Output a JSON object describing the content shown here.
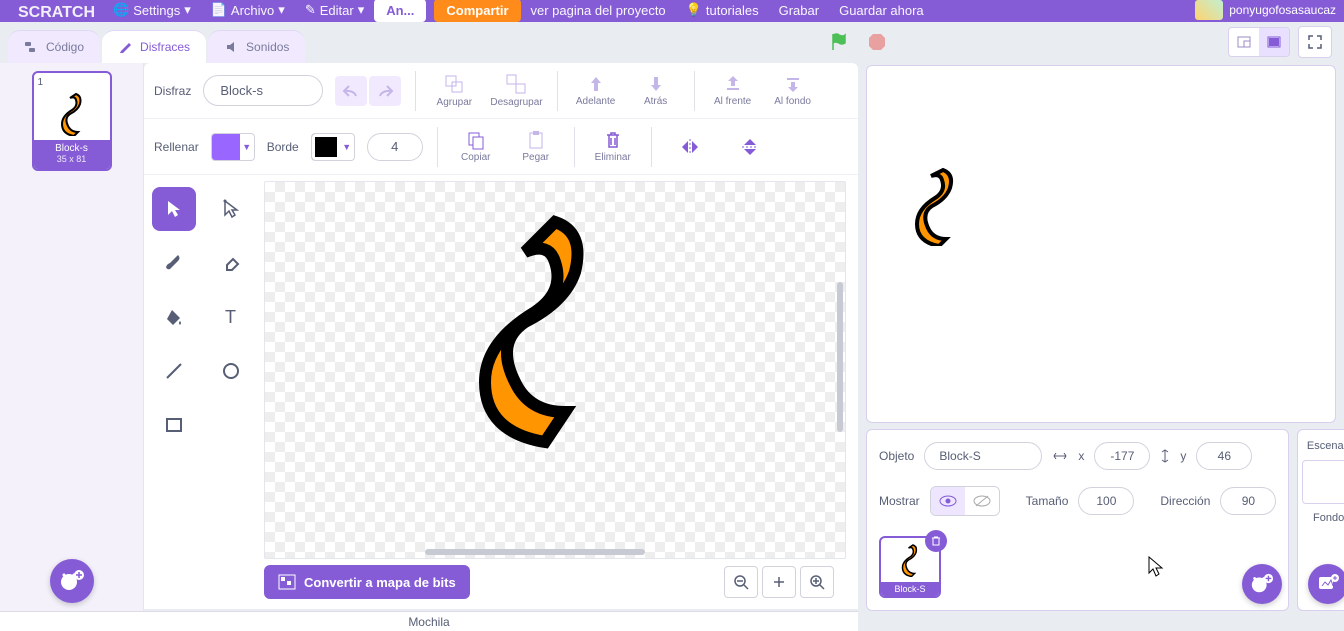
{
  "menu": {
    "settings": "Settings",
    "archivo": "Archivo",
    "editar": "Editar",
    "an": "An...",
    "compartir": "Compartir",
    "ver_pagina": "ver pagina del proyecto",
    "tutoriales": "tutoriales",
    "grabar": "Grabar",
    "guardar": "Guardar ahora",
    "username": "ponyugofosasaucaz"
  },
  "tabs": {
    "codigo": "Código",
    "disfraces": "Disfraces",
    "sonidos": "Sonidos"
  },
  "costume_list": {
    "index": "1",
    "name": "Block-s",
    "dims": "35 x 81"
  },
  "paint": {
    "costume_lbl": "Disfraz",
    "costume_name": "Block-s",
    "agrupar": "Agrupar",
    "desagrupar": "Desagrupar",
    "adelante": "Adelante",
    "atras": "Atrás",
    "al_frente": "Al frente",
    "al_fondo": "Al fondo",
    "rellenar": "Rellenar",
    "borde": "Borde",
    "outline_w": "4",
    "copiar": "Copiar",
    "pegar": "Pegar",
    "eliminar": "Eliminar",
    "fill_color": "#9966ff",
    "border_color": "#000000",
    "convert": "Convertir a mapa de bits"
  },
  "sprite": {
    "objeto_lbl": "Objeto",
    "name": "Block-S",
    "x_lbl": "x",
    "x": "-177",
    "y_lbl": "y",
    "y": "46",
    "mostrar": "Mostrar",
    "tamano_lbl": "Tamaño",
    "tamano": "100",
    "direccion_lbl": "Dirección",
    "direccion": "90",
    "thumb_label": "Block-S"
  },
  "stage_side": {
    "escenario": "Escenario",
    "fondos": "Fondos"
  },
  "backpack": "Mochila"
}
